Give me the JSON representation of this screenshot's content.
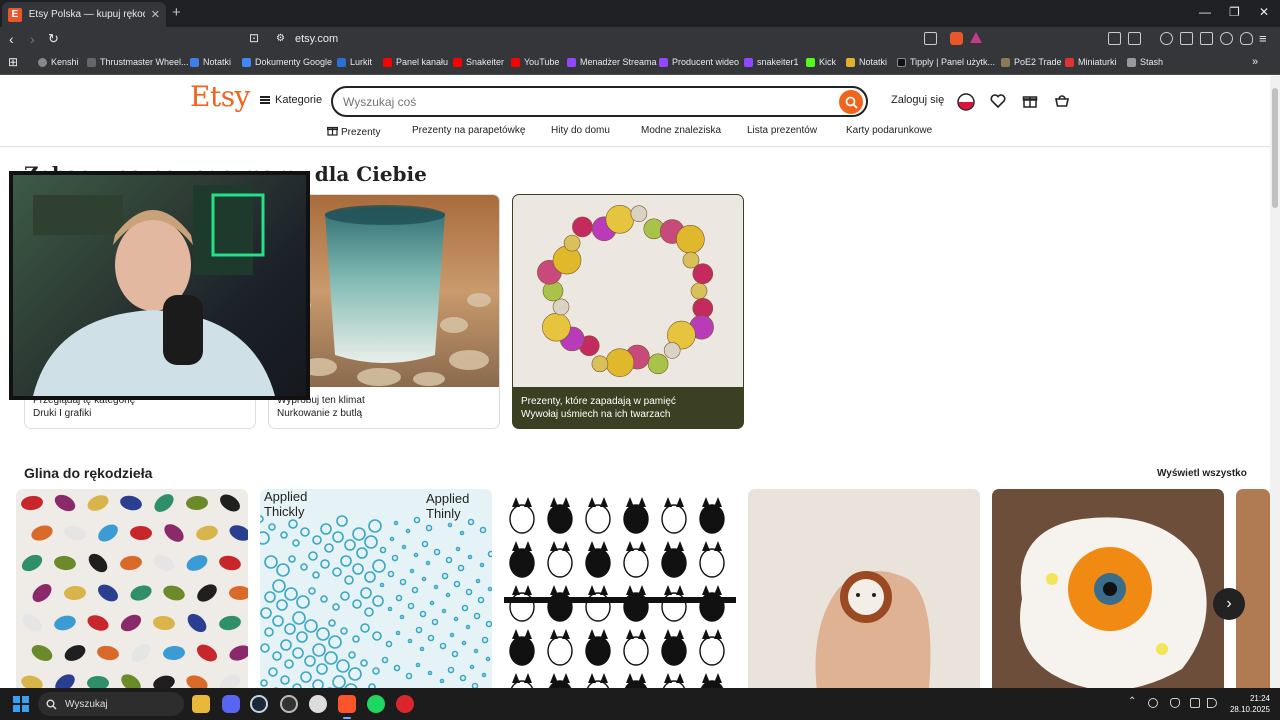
{
  "browser": {
    "tab_title": "Etsy Polska — kupuj rękodzieło,",
    "tab_favicon": "E",
    "url": "etsy.com",
    "bookmarks": [
      "Kenshi",
      "Thrustmaster Wheel...",
      "Notatki",
      "Dokumenty Google",
      "Lurkit",
      "Panel kanału",
      "Snakeiter",
      "YouTube",
      "Menadżer Streama",
      "Producent wideo",
      "snakeiter1",
      "Kick",
      "Notatki",
      "Tipply | Panel użytk...",
      "PoE2 Trade",
      "Miniaturki",
      "Stash"
    ]
  },
  "etsy": {
    "logo": "Etsy",
    "categories_label": "Kategorie",
    "search_placeholder": "Wyszukaj coś",
    "signin": "Zaloguj się",
    "subnav": [
      "Prezenty",
      "Prezenty na parapetówkę",
      "Hity do domu",
      "Modne znaleziska",
      "Lista prezentów",
      "Karty podarunkowe"
    ],
    "heading": "Zobacz, co nowego mamy dla Ciebie",
    "cards": [
      {
        "line1": "Przeglądaj tę kategorię",
        "line2": "Druki I grafiki"
      },
      {
        "line1": "Wypróbuj ten klimat",
        "line2": "Nurkowanie z butlą"
      },
      {
        "line1": "Prezenty, które zapadają w pamięć",
        "line2": "Wywołaj uśmiech na ich twarzach"
      }
    ],
    "section_title": "Glina do rękodzieła",
    "view_all": "Wyświetl wszystko",
    "product_labels": {
      "applied_thickly": "Applied Thickly",
      "applied_thinly": "Applied Thinly"
    }
  },
  "taskbar": {
    "search_label": "Wyszukaj",
    "time": "21:24",
    "date": "28.10.2025"
  }
}
